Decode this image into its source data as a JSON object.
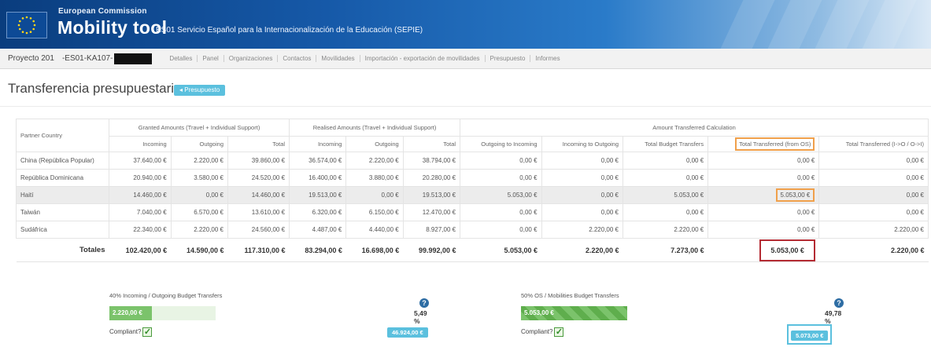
{
  "header": {
    "org": "European Commission",
    "app": "Mobility tool",
    "agency": "ES01 Servicio Español para la Internacionalización de la Educación (SEPIE)"
  },
  "nav": {
    "project_label": "Proyecto 201",
    "project_code": "-ES01-KA107-",
    "menu": [
      "Detalles",
      "Panel",
      "Organizaciones",
      "Contactos",
      "Movilidades",
      "Importación - exportación de movilidades",
      "Presupuesto",
      "Informes"
    ]
  },
  "page": {
    "title": "Transferencia presupuestaria",
    "badge": "◂ Presupuesto"
  },
  "table": {
    "group_headers": {
      "partner": "Partner Country",
      "granted": "Granted Amounts (Travel + Individual Support)",
      "realised": "Realised Amounts (Travel + Individual Support)",
      "calculator": "Amount Transferred Calculation"
    },
    "sub_headers": [
      "Incoming",
      "Outgoing",
      "Total",
      "Incoming",
      "Outgoing",
      "Total",
      "Outgoing to Incoming",
      "Incoming to Outgoing",
      "Total Budget Transfers",
      "Total Transferred (from OS)",
      "Total Transferred (I->O / O->I)"
    ],
    "rows": [
      {
        "country": "China (República Popular)",
        "cells": [
          "37.640,00 €",
          "2.220,00 €",
          "39.860,00 €",
          "36.574,00 €",
          "2.220,00 €",
          "38.794,00 €",
          "0,00 €",
          "0,00 €",
          "0,00 €",
          "0,00 €",
          "0,00 €"
        ]
      },
      {
        "country": "República Dominicana",
        "cells": [
          "20.940,00 €",
          "3.580,00 €",
          "24.520,00 €",
          "16.400,00 €",
          "3.880,00 €",
          "20.280,00 €",
          "0,00 €",
          "0,00 €",
          "0,00 €",
          "0,00 €",
          "0,00 €"
        ]
      },
      {
        "country": "Haití",
        "cells": [
          "14.460,00 €",
          "0,00 €",
          "14.460,00 €",
          "19.513,00 €",
          "0,00 €",
          "19.513,00 €",
          "5.053,00 €",
          "0,00 €",
          "5.053,00 €",
          "5.053,00 €",
          "0,00 €"
        ]
      },
      {
        "country": "Taiwán",
        "cells": [
          "7.040,00 €",
          "6.570,00 €",
          "13.610,00 €",
          "6.320,00 €",
          "6.150,00 €",
          "12.470,00 €",
          "0,00 €",
          "0,00 €",
          "0,00 €",
          "0,00 €",
          "0,00 €"
        ]
      },
      {
        "country": "Sudáfrica",
        "cells": [
          "22.340,00 €",
          "2.220,00 €",
          "24.560,00 €",
          "4.487,00 €",
          "4.440,00 €",
          "8.927,00 €",
          "0,00 €",
          "2.220,00 €",
          "2.220,00 €",
          "0,00 €",
          "2.220,00 €"
        ]
      }
    ],
    "totals_label": "Totales",
    "totals": [
      "102.420,00 €",
      "14.590,00 €",
      "117.310,00 €",
      "83.294,00 €",
      "16.698,00 €",
      "99.992,00 €",
      "5.053,00 €",
      "2.220,00 €",
      "7.273,00 €",
      "5.053,00 €",
      "2.220,00 €"
    ]
  },
  "panels": {
    "left": {
      "title": "40% Incoming / Outgoing Budget Transfers",
      "bar_value": "2.220,00 €",
      "fill_percent": 40,
      "percent": "5,49 %",
      "compliant_label": "Compliant?",
      "badge": "46.924,00 €"
    },
    "right": {
      "title": "50% OS / Mobilities Budget Transfers",
      "bar_value": "5.053,00 €",
      "fill_percent": 100,
      "percent": "49,78 %",
      "compliant_label": "Compliant?",
      "badge": "5.073,00 €"
    }
  },
  "colors": {
    "header_blue": "#0a3d7e",
    "accent_info": "#5bc0de",
    "bar_green": "#7bc36b",
    "highlight_orange": "#f0a04b",
    "highlight_red": "#b42b33"
  }
}
